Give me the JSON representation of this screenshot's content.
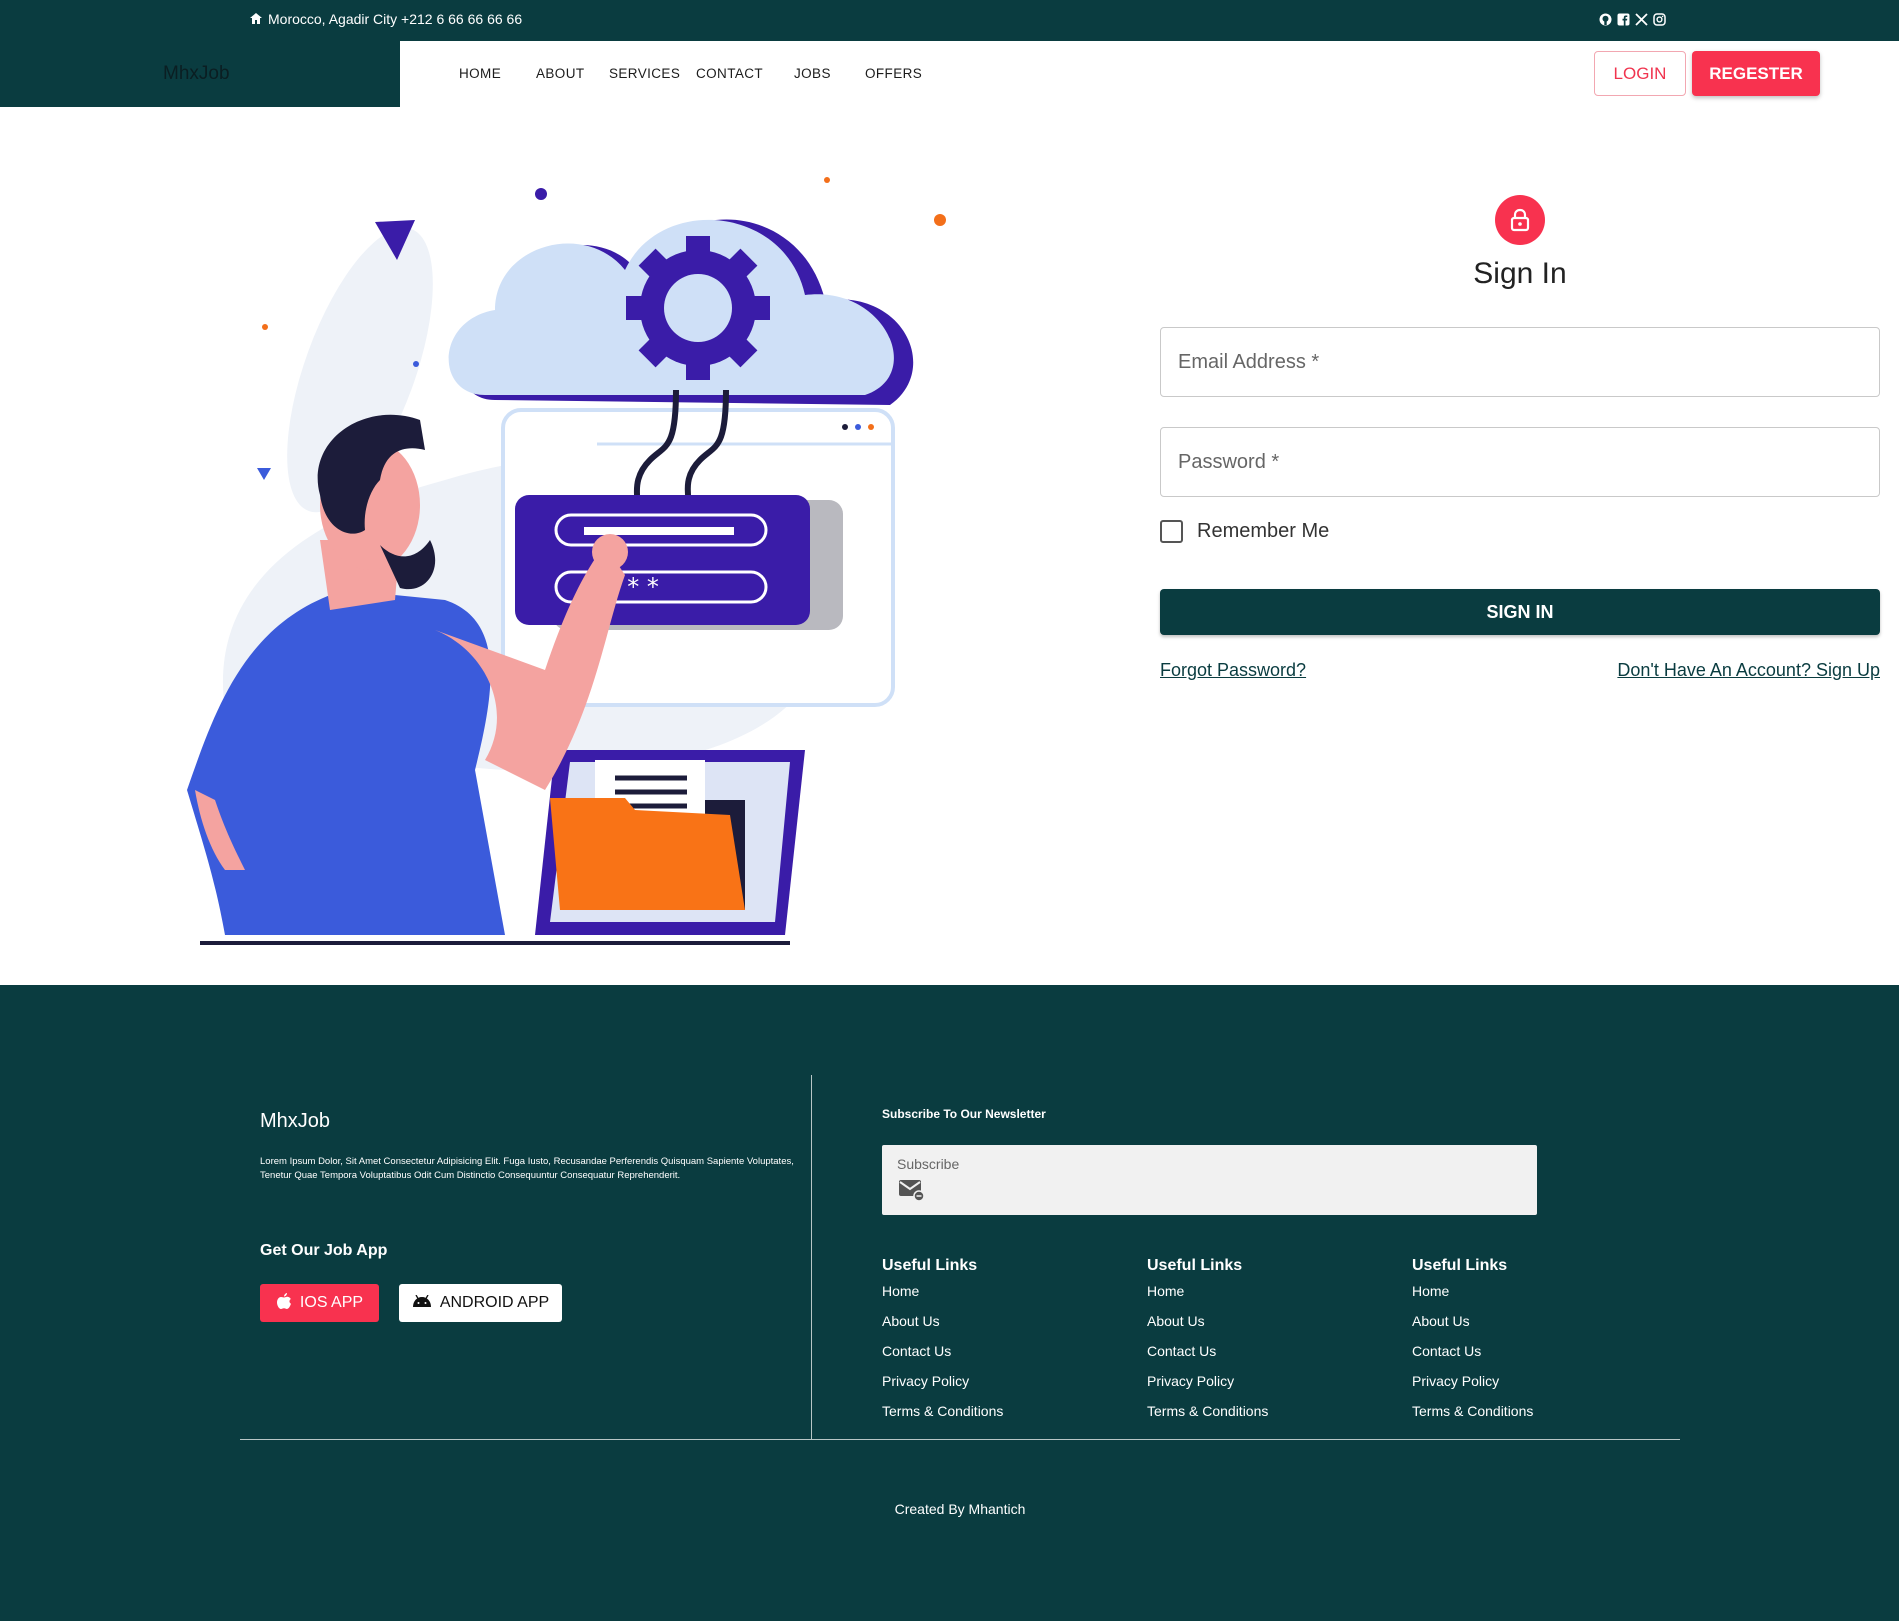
{
  "topbar": {
    "location": "Morocco, Agadir City +212 6 66 66 66 66",
    "social": [
      "github-icon",
      "facebook-icon",
      "x-icon",
      "instagram-icon"
    ]
  },
  "brand": "MhxJob",
  "nav": {
    "items": [
      "HOME",
      "ABOUT",
      "SERVICES",
      "CONTACT",
      "JOBS",
      "OFFERS"
    ],
    "login": "LOGIN",
    "register": "REGESTER"
  },
  "signin": {
    "title": "Sign In",
    "email_placeholder": "Email Address *",
    "password_placeholder": "Password *",
    "remember": "Remember Me",
    "submit": "SIGN IN",
    "forgot": "Forgot Password?",
    "signup": "Don't Have An Account? Sign Up"
  },
  "footer": {
    "brand": "MhxJob",
    "description_line1": "Lorem Ipsum Dolor, Sit Amet Consectetur Adipisicing Elit. Fuga Iusto, Recusandae Perferendis Quisquam Sapiente Voluptates,",
    "description_line2": "Tenetur Quae Tempora Voluptatibus Odit Cum Distinctio Consequuntur Consequatur Reprehenderit.",
    "app_title": "Get Our Job App",
    "ios_app": "IOS APP",
    "android_app": "ANDROID APP",
    "newsletter_title": "Subscribe To Our Newsletter",
    "subscribe_placeholder": "Subscribe",
    "columns": [
      {
        "title": "Useful Links",
        "links": [
          "Home",
          "About Us",
          "Contact Us",
          "Privacy Policy",
          "Terms & Conditions"
        ]
      },
      {
        "title": "Useful Links",
        "links": [
          "Home",
          "About Us",
          "Contact Us",
          "Privacy Policy",
          "Terms & Conditions"
        ]
      },
      {
        "title": "Useful Links",
        "links": [
          "Home",
          "About Us",
          "Contact Us",
          "Privacy Policy",
          "Terms & Conditions"
        ]
      }
    ],
    "credit": "Created By Mhantich"
  },
  "colors": {
    "dark_teal": "#0a3c40",
    "accent_red": "#f8324f"
  }
}
